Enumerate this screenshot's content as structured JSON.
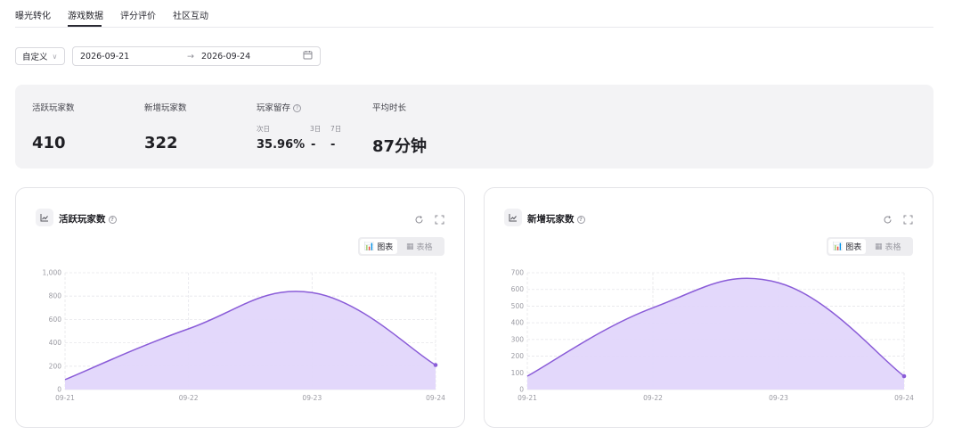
{
  "tabs": [
    {
      "label": "曝光转化"
    },
    {
      "label": "游戏数据"
    },
    {
      "label": "评分评价"
    },
    {
      "label": "社区互动"
    }
  ],
  "filter": {
    "preset": "自定义",
    "start_date": "2026-09-21",
    "arrow": "→",
    "end_date": "2026-09-24"
  },
  "stats": {
    "active_label": "活跃玩家数",
    "active_value": "410",
    "new_label": "新增玩家数",
    "new_value": "322",
    "retention_label": "玩家留存",
    "retention_d1_label": "次日",
    "retention_d3_label": "3日",
    "retention_d7_label": "7日",
    "retention_d1_value": "35.96%",
    "retention_d3_value": "-",
    "retention_d7_value": "-",
    "avg_label": "平均时长",
    "avg_value": "87分钟"
  },
  "cards": [
    {
      "title": "活跃玩家数",
      "chart_btn": "图表",
      "table_btn": "表格"
    },
    {
      "title": "新增玩家数",
      "chart_btn": "图表",
      "table_btn": "表格"
    }
  ],
  "colors": {
    "line": "#8a5cd8",
    "area": "#e1d6fb",
    "grid": "#e6e6ea"
  },
  "icons": [
    "line-chart-icon",
    "help-icon",
    "refresh-icon",
    "fullscreen-icon",
    "bar-chart-icon",
    "table-icon",
    "calendar-icon",
    "chevron-down-icon"
  ],
  "chart_data": [
    {
      "type": "area",
      "title": "活跃玩家数",
      "x": [
        "09-21",
        "09-22",
        "09-23",
        "09-24"
      ],
      "series": [
        {
          "values": [
            85,
            520,
            830,
            210
          ]
        }
      ],
      "ylim": [
        0,
        1000
      ],
      "yticks": [
        "0",
        "200",
        "400",
        "600",
        "800",
        "1,000"
      ],
      "grid": true
    },
    {
      "type": "area",
      "title": "新增玩家数",
      "x": [
        "09-21",
        "09-22",
        "09-23",
        "09-24"
      ],
      "series": [
        {
          "values": [
            80,
            490,
            640,
            80
          ]
        }
      ],
      "ylim": [
        0,
        700
      ],
      "yticks": [
        "0",
        "100",
        "200",
        "300",
        "400",
        "500",
        "600",
        "700"
      ],
      "grid": true
    }
  ]
}
